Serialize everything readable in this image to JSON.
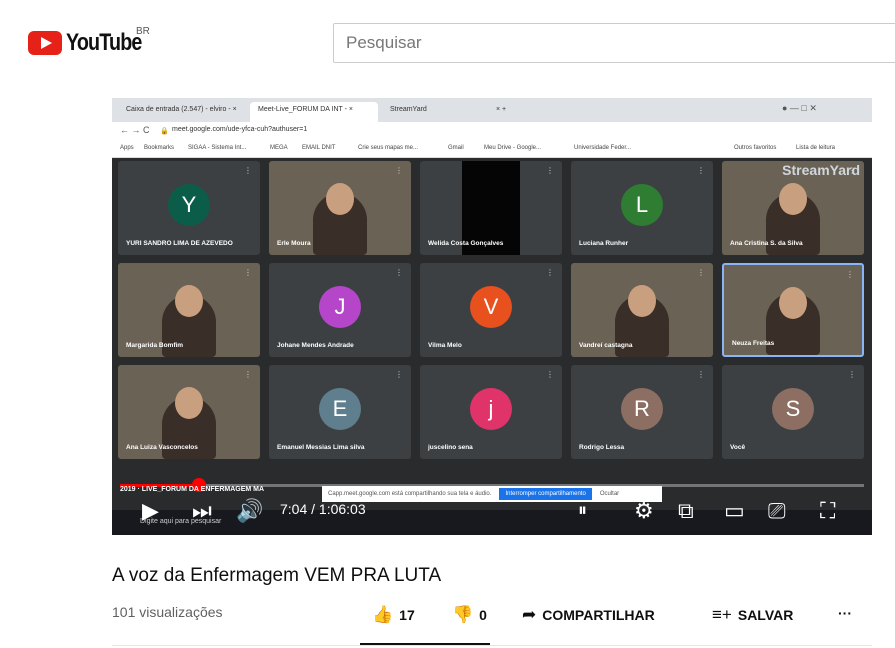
{
  "header": {
    "logo_text": "YouTube",
    "country_code": "BR",
    "search_placeholder": "Pesquisar"
  },
  "browser": {
    "tabs": [
      {
        "label": "Caixa de entrada (2.547) - elviro - ×"
      },
      {
        "label": "Meet-Live_FORUM DA INT - ×"
      },
      {
        "label": "StreamYard"
      },
      {
        "label": "×   +"
      }
    ],
    "url": "meet.google.com/ude-yfca-cuh?authuser=1",
    "bookmarks": [
      "Apps",
      "Bookmarks",
      "SIGAA - Sistema Int...",
      "MEGA",
      "EMAIL DNIT",
      "Crie seus mapas me...",
      "Gmail",
      "Meu Drive - Google...",
      "Universidade Feder...",
      "Outros favoritos",
      "Lista de leitura"
    ]
  },
  "meet": {
    "brand": "StreamYard",
    "tiles": [
      {
        "name": "YURI SANDRO LIMA DE AZEVEDO",
        "initial": "Y",
        "color": "#0b5d4a",
        "type": "avatar"
      },
      {
        "name": "Erle Moura",
        "initial": "",
        "color": "",
        "type": "camera"
      },
      {
        "name": "Welida Costa Gonçalves",
        "initial": "",
        "color": "",
        "type": "black"
      },
      {
        "name": "Luciana Runher",
        "initial": "L",
        "color": "#2e7d32",
        "type": "avatar"
      },
      {
        "name": "Ana Cristina S. da Silva",
        "initial": "",
        "color": "",
        "type": "camera"
      },
      {
        "name": "Margarida Bomfim",
        "initial": "",
        "color": "",
        "type": "camera"
      },
      {
        "name": "Johane Mendes Andrade",
        "initial": "J",
        "color": "#b545c9",
        "type": "avatar"
      },
      {
        "name": "Vilma Melo",
        "initial": "V",
        "color": "#e8501e",
        "type": "avatar"
      },
      {
        "name": "Vandreí castagna",
        "initial": "",
        "color": "",
        "type": "camera"
      },
      {
        "name": "Neuza Freitas",
        "initial": "",
        "color": "",
        "type": "camera"
      },
      {
        "name": "Ana Luiza Vasconcelos",
        "initial": "",
        "color": "",
        "type": "camera"
      },
      {
        "name": "Emanuel Messias Lima silva",
        "initial": "E",
        "color": "#5f7f8f",
        "type": "avatar"
      },
      {
        "name": "juscelino sena",
        "initial": "j",
        "color": "#e0336a",
        "type": "avatar"
      },
      {
        "name": "Rodrigo Lessa",
        "initial": "R",
        "color": "#8d6e63",
        "type": "avatar"
      },
      {
        "name": "Você",
        "initial": "S",
        "color": "#8d6e63",
        "type": "avatar"
      }
    ]
  },
  "player": {
    "time_display": "7:04 / 1:06:03",
    "progress_fraction": 0.106,
    "video_overlay_title": "2019 · LIVE_FORUM DA ENFERMAGEM MA",
    "share_banner_text": "Capp.meet.google.com está compartilhando sua tela e áudio.",
    "share_banner_button": "Interromper compartilhamento",
    "share_banner_hide": "Ocultar",
    "taskbar_search": "Digite aqui para pesquisar"
  },
  "video_info": {
    "title": "A voz da Enfermagem VEM PRA LUTA",
    "views": "101 visualizações",
    "likes": "17",
    "dislikes": "0",
    "share_label": "COMPARTILHAR",
    "save_label": "SALVAR",
    "more": "···"
  },
  "colors": {
    "brand_red": "#ff0000",
    "text_primary": "#0f0f0f",
    "text_secondary": "#606060"
  }
}
